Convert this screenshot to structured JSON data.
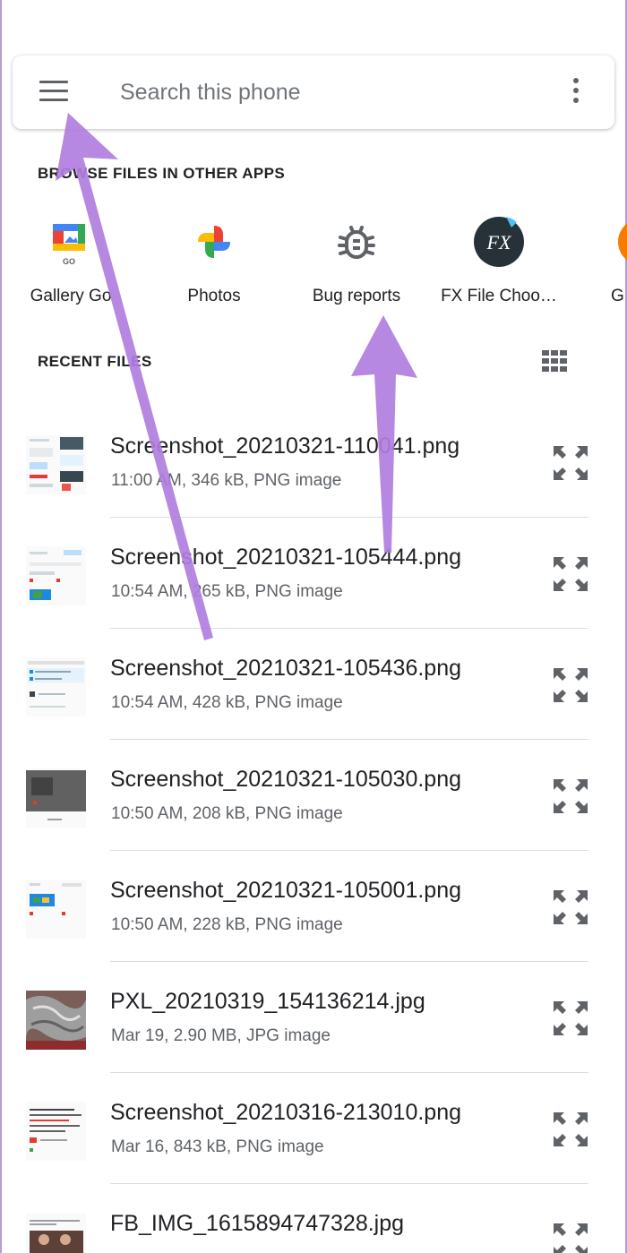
{
  "search": {
    "placeholder": "Search this phone"
  },
  "browse": {
    "title": "BROWSE FILES IN OTHER APPS",
    "apps": [
      {
        "label": "Gallery Go",
        "icon": "gallery-go-icon"
      },
      {
        "label": "Photos",
        "icon": "google-photos-icon"
      },
      {
        "label": "Bug reports",
        "icon": "bug-icon"
      },
      {
        "label": "FX File Choo…",
        "icon": "fx-file-icon"
      },
      {
        "label": "G",
        "icon": "partial-app-icon"
      }
    ]
  },
  "recent": {
    "title": "RECENT FILES",
    "files": [
      {
        "name": "Screenshot_20210321-110041.png",
        "meta": "11:00 AM, 346 kB, PNG image"
      },
      {
        "name": "Screenshot_20210321-105444.png",
        "meta": "10:54 AM, 265 kB, PNG image"
      },
      {
        "name": "Screenshot_20210321-105436.png",
        "meta": "10:54 AM, 428 kB, PNG image"
      },
      {
        "name": "Screenshot_20210321-105030.png",
        "meta": "10:50 AM, 208 kB, PNG image"
      },
      {
        "name": "Screenshot_20210321-105001.png",
        "meta": "10:50 AM, 228 kB, PNG image"
      },
      {
        "name": "PXL_20210319_154136214.jpg",
        "meta": "Mar 19, 2.90 MB, JPG image"
      },
      {
        "name": "Screenshot_20210316-213010.png",
        "meta": "Mar 16, 843 kB, PNG image"
      },
      {
        "name": "FB_IMG_1615894747328.jpg",
        "meta": ""
      }
    ]
  },
  "colors": {
    "annotation_arrow": "#b07ee0",
    "icon_gray": "#5f6368",
    "divider": "#dadce0"
  }
}
